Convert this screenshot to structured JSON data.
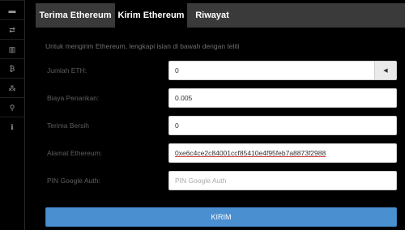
{
  "sidebar": {
    "icons": [
      {
        "name": "menu-bar-icon",
        "glyph": "▬"
      },
      {
        "name": "transfer-icon",
        "glyph": "⇄"
      },
      {
        "name": "bar-chart-icon",
        "glyph": "▥"
      },
      {
        "name": "bitcoin-icon",
        "glyph": "₿"
      },
      {
        "name": "pair-icon",
        "glyph": "⁂"
      },
      {
        "name": "link-icon",
        "glyph": "⚲"
      },
      {
        "name": "info-icon",
        "glyph": "ℹ"
      }
    ]
  },
  "tabs": [
    {
      "label": "Terima Ethereum",
      "active": false
    },
    {
      "label": "Kirim Ethereum",
      "active": true
    },
    {
      "label": "Riwayat",
      "active": false
    }
  ],
  "form": {
    "intro": "Untuk mengirim Ethereum, lengkapi isian di bawah dengan teliti",
    "amount_label": "Jumlah ETH:",
    "amount_value": "0",
    "fee_label": "Biaya Penarikan:",
    "fee_value": "0.005",
    "net_label": "Terima Bersih",
    "net_value": "0",
    "address_label": "Alamat Ethereum:",
    "address_value": "0xe6c4ce2c84001ccf85410e4f95feb7a8873f2988",
    "pin_label": "PIN Google Auth:",
    "pin_placeholder": "PIN Google Auth",
    "submit_label": "KIRIM"
  },
  "colors": {
    "tab_bar": "#3a3a3a",
    "submit": "#4a8fd0"
  }
}
